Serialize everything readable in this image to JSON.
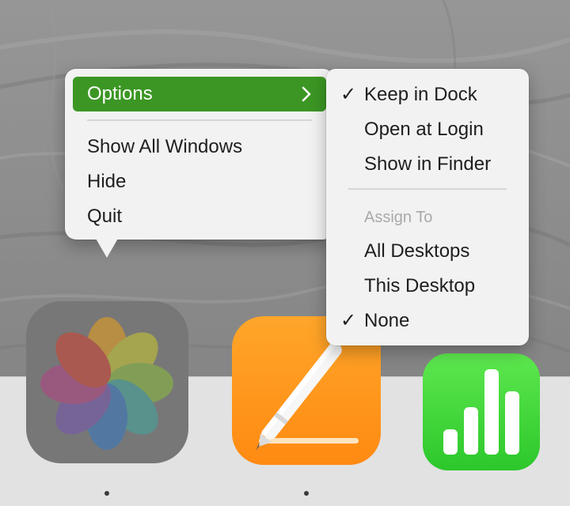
{
  "context_menu": {
    "options_label": "Options",
    "items": [
      "Show All Windows",
      "Hide",
      "Quit"
    ]
  },
  "options_submenu": {
    "keep_in_dock": {
      "label": "Keep in Dock",
      "checked": true
    },
    "open_at_login": {
      "label": "Open at Login",
      "checked": false
    },
    "show_in_finder": {
      "label": "Show in Finder",
      "checked": false
    },
    "assign_to_header": "Assign To",
    "all_desktops": {
      "label": "All Desktops",
      "checked": false
    },
    "this_desktop": {
      "label": "This Desktop",
      "checked": false
    },
    "none": {
      "label": "None",
      "checked": true
    }
  },
  "check_glyph": "✓",
  "dock": {
    "apps": [
      {
        "icon": "photos-icon",
        "running": true
      },
      {
        "icon": "pages-icon",
        "running": true
      },
      {
        "icon": "numbers-icon",
        "running": false
      }
    ]
  },
  "colors": {
    "highlight": "#3b9623",
    "menu_background": "#f2f2f2",
    "dock_background": "#e2e2e2"
  }
}
